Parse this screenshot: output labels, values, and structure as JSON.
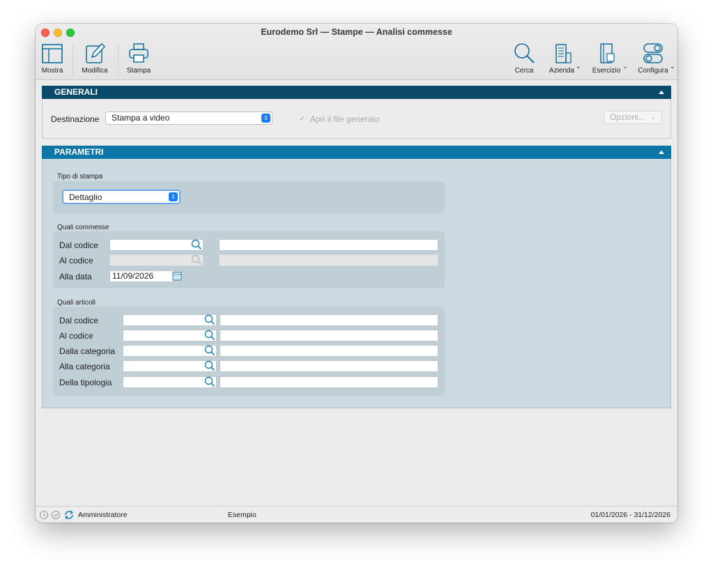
{
  "window": {
    "title": "Eurodemo Srl — Stampe — Analisi commesse"
  },
  "toolbar": {
    "mostra": "Mostra",
    "modifica": "Modifica",
    "stampa": "Stampa",
    "cerca": "Cerca",
    "azienda": "Azienda",
    "esercizio": "Esercizio",
    "configura": "Configura"
  },
  "generali": {
    "header": "GENERALI",
    "destinazione_label": "Destinazione",
    "destinazione_value": "Stampa a video",
    "apri_file_label": "Apri il file generato",
    "opzioni_label": "Opzioni..."
  },
  "parametri": {
    "header": "PARAMETRI",
    "tipo_stampa_label": "Tipo di stampa",
    "tipo_stampa_value": "Dettaglio",
    "quali_commesse": {
      "title": "Quali commesse",
      "dal_codice": "Dal codice",
      "al_codice": "Al codice",
      "alla_data": "Alla data",
      "alla_data_value": "11/09/2026"
    },
    "quali_articoli": {
      "title": "Quali articoli",
      "dal_codice": "Dal codice",
      "al_codice": "Al codice",
      "dalla_categoria": "Dalla categoria",
      "alla_categoria": "Alla categoria",
      "della_tipologia": "Della tipologia"
    }
  },
  "statusbar": {
    "user": "Amministratore",
    "database": "Esempio",
    "period": "01/01/2026 - 31/12/2026"
  }
}
